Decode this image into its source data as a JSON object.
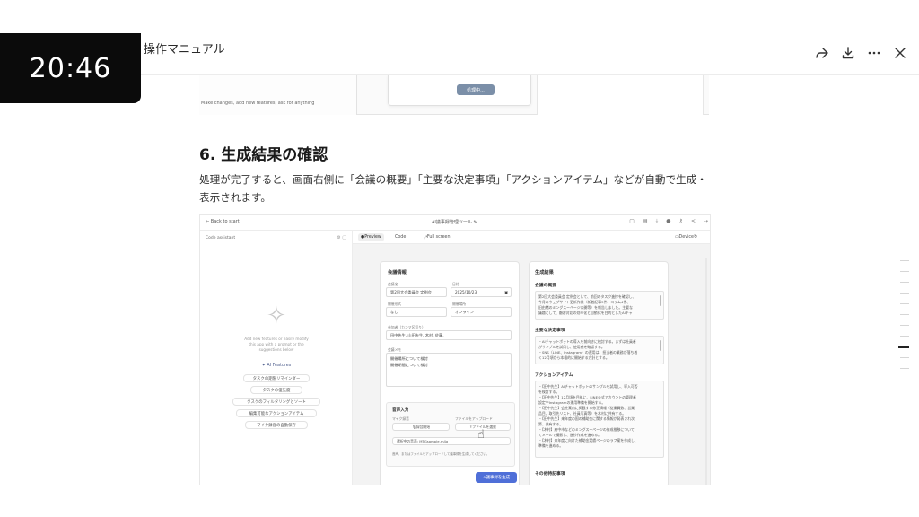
{
  "timer": "20:46",
  "header": {
    "title": "操作マニュアル",
    "share_icon": "share-icon",
    "download_icon": "download-icon",
    "more_icon": "more-icon",
    "close_icon": "close-icon"
  },
  "prev_shot": {
    "prompt_placeholder": "Make changes, add new features, ask for anything",
    "processing_button": "処理中..."
  },
  "section": {
    "heading": "6. 生成結果の確認",
    "body": "処理が完了すると、画面右側に「会議の概要」「主要な決定事項」「アクションアイテム」などが自動で生成・表示されます。"
  },
  "app": {
    "back_link": "← Back to start",
    "app_title": "AI議事録管理ツール ✎",
    "assistant_label": "Code assistant",
    "assistant_hint": "Add new features or easily modify this app with a prompt or the suggestions below",
    "ai_features": "AI Features",
    "suggestions": [
      "タスクの期限リマインダー",
      "タスクの優先度",
      "タスクのフィルタリングとソート",
      "編集可能なアクションアイテム",
      "マイク録音の自動保存"
    ],
    "tabs": {
      "preview": "Preview",
      "code": "Code",
      "fullscreen": "Full screen",
      "device": "Device"
    },
    "form": {
      "title": "会議情報",
      "meeting_name_label": "会議名",
      "meeting_name": "第2回大会委員会 定例会",
      "date_label": "日付",
      "date": "2025/10/23",
      "venue_label": "開催形式",
      "venue": "なし",
      "place_label": "開催場所",
      "place": "オンライン",
      "attendees_label": "参加者（カンマ区切り）",
      "attendees": "田中先生, 山田先生, 木村, 佐藤,",
      "memo_label": "会議メモ",
      "memo_lines": [
        "開催場所について検討",
        "開催期間について検討"
      ],
      "audio_title": "音声入力",
      "mic_label": "マイク録音",
      "upload_label": "ファイルをアップロード",
      "record_button": "録音開始",
      "select_file_button": "ファイルを選択",
      "selected_file": "選択中の音声: MTGsample.m4a",
      "audio_note": "音声、またはファイルをアップロードして議事録を生成してください。",
      "generate_button": "議事録を生成"
    },
    "result": {
      "title": "生成結果",
      "overview_title": "会議の概要",
      "overview_lines": [
        "第2回大会委員会 定例会として、前回のタスク進捗を確認し、",
        "今月のウェブサイト更新作業（新着記事3件、コラム4件、",
        "旧由緒のミングスーページ公開等）を報告しました。主要な",
        "議題として、顧客対応の効率化と自動化を目的としたAIチャ"
      ],
      "decisions_title": "主要な決定事項",
      "decision_lines": [
        "・AIチャットボットの導入を前向きに検討する。まずは社員者",
        "がサンプルを試用し、使用感を確認する。",
        "・SNS（LINE、Instagram）の運用は、担当者の業務が落ち着",
        "く12月頃から本格的に開始する方針とする。"
      ],
      "actions_title": "アクションアイテム",
      "action_lines": [
        "・【田中先生】AIチャットボットのサンプルを試用し、導入可否",
        "を検討する。",
        "・【田中先生】12月頃を目処に、LINE公式アカウントの管理者",
        "設定やInstagramの運用準備を開始する。",
        "・【田中先生】会社案内に掲載する修正情報（従業員数、営業",
        "品目、取引先リスト、社員写真等）を木村に共有する。",
        "・【田中先生】来年度の国の補助金に関する情報が発表され次",
        "第、共有する。",
        "・【木村】府中市などのミングスーページの作成推移について",
        "てメールで撮影し、進捗作成を進める。",
        "・【木村】来年度に向けた補助金実績ページのラフ案を作成し、",
        "準備を進める。"
      ],
      "other_title": "その他特記事項"
    }
  }
}
